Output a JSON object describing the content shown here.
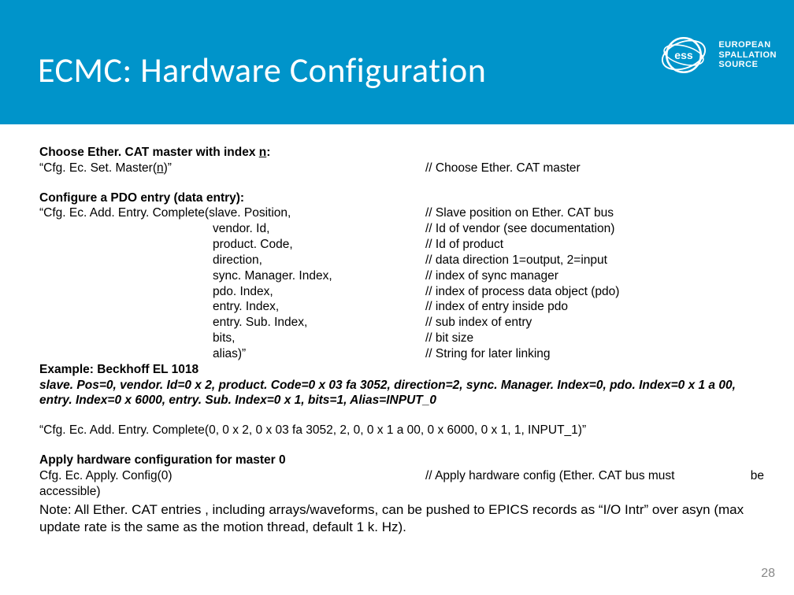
{
  "header": {
    "title": "ECMC: Hardware Configuration",
    "org_line1": "EUROPEAN",
    "org_line2": "SPALLATION",
    "org_line3": "SOURCE"
  },
  "section1": {
    "heading_prefix": "Choose Ether. CAT master with index ",
    "heading_n": "n",
    "heading_suffix": ":",
    "line_left": "“Cfg. Ec. Set. Master(",
    "line_n": "n",
    "line_close": ")”",
    "line_right": "// Choose Ether. CAT master"
  },
  "section2": {
    "heading": "Configure a PDO entry (data entry):",
    "params": [
      {
        "left": "“Cfg. Ec. Add. Entry. Complete(slave. Position,",
        "right": "// Slave position on Ether. CAT bus"
      },
      {
        "left": "vendor. Id,",
        "right": "// Id of vendor (see documentation)"
      },
      {
        "left": "product. Code,",
        "right": "// Id of product"
      },
      {
        "left": "direction,",
        "right": "// data direction 1=output, 2=input"
      },
      {
        "left": "sync. Manager. Index,",
        "right": "// index of sync manager"
      },
      {
        "left": "pdo. Index,",
        "right": "// index of process data object (pdo)"
      },
      {
        "left": "entry. Index,",
        "right": "// index of entry inside pdo"
      },
      {
        "left": "entry. Sub. Index,",
        "right": "// sub index of entry"
      },
      {
        "left": "bits,",
        "right": "// bit size"
      },
      {
        "left": "alias)”",
        "right": "// String for later linking"
      }
    ],
    "example_label": "Example: Beckhoff EL 1018",
    "example_vals": "slave. Pos=0, vendor. Id=0 x 2, product. Code=0 x 03 fa 3052, direction=2, sync. Manager. Index=0, pdo. Index=0 x 1 a 00, entry. Index=0 x 6000, entry. Sub. Index=0 x 1, bits=1, Alias=INPUT_0",
    "call": "“Cfg. Ec. Add. Entry. Complete(0, 0 x 2, 0 x 03 fa 3052, 2, 0, 0 x 1 a 00, 0 x 6000, 0 x 1, 1, INPUT_1)”"
  },
  "section3": {
    "heading": "Apply hardware configuration for master 0",
    "line_left": "Cfg. Ec. Apply. Config(0)",
    "line_right": "// Apply hardware config (Ether. CAT bus must",
    "line_tail": "be",
    "line2": "accessible)"
  },
  "note": "Note: All Ether. CAT entries , including arrays/waveforms, can be pushed to EPICS records as “I/O Intr” over asyn (max update rate is the same as the motion thread, default 1 k. Hz).",
  "page_number": "28"
}
